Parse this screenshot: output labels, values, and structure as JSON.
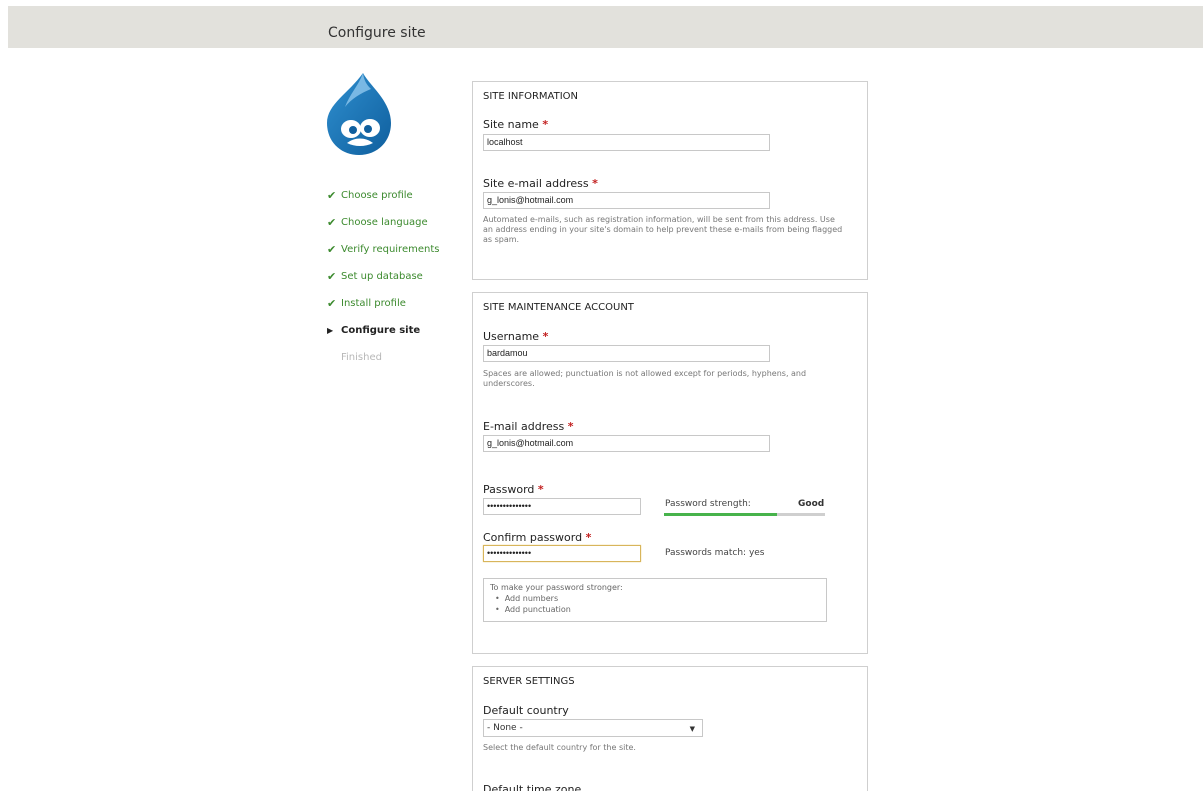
{
  "header": {
    "title": "Configure site"
  },
  "steps": [
    {
      "label": "Choose profile",
      "state": "done"
    },
    {
      "label": "Choose language",
      "state": "done"
    },
    {
      "label": "Verify requirements",
      "state": "done"
    },
    {
      "label": "Set up database",
      "state": "done"
    },
    {
      "label": "Install profile",
      "state": "done"
    },
    {
      "label": "Configure site",
      "state": "active"
    },
    {
      "label": "Finished",
      "state": "pending"
    }
  ],
  "site_info": {
    "legend": "SITE INFORMATION",
    "site_name_label": "Site name",
    "site_name_value": "localhost",
    "site_email_label": "Site e-mail address",
    "site_email_value": "g_lonis@hotmail.com",
    "site_email_desc_1": "Automated e-mails, such as registration information, will be sent from this address. Use",
    "site_email_desc_2": "an address ending in your site's domain to help prevent these e-mails from being flagged",
    "site_email_desc_3": "as spam."
  },
  "maintenance": {
    "legend": "SITE MAINTENANCE ACCOUNT",
    "username_label": "Username",
    "username_value": "bardamou",
    "username_desc_1": "Spaces are allowed; punctuation is not allowed except for periods, hyphens, and",
    "username_desc_2": "underscores.",
    "email_label": "E-mail address",
    "email_value": "g_lonis@hotmail.com",
    "password_label": "Password",
    "password_value": "••••••••••••••",
    "strength_label": "Password strength:",
    "strength_value": "Good",
    "strength_percent": 70,
    "confirm_label": "Confirm password",
    "confirm_value": "••••••••••••••",
    "match_text": "Passwords match: yes",
    "tips_title": "To make your password stronger:",
    "tips": [
      "Add numbers",
      "Add punctuation"
    ]
  },
  "server": {
    "legend": "SERVER SETTINGS",
    "country_label": "Default country",
    "country_value": "- None -",
    "country_desc": "Select the default country for the site.",
    "timezone_label": "Default time zone"
  },
  "required_marker": "*",
  "colors": {
    "header_bg": "#e2e1dc",
    "done_green": "#3c8a2e",
    "strength_green": "#47b34b",
    "required_red": "#c21f1f"
  },
  "icons": {
    "done": "checkmark-icon",
    "active": "triangle-right-icon"
  }
}
